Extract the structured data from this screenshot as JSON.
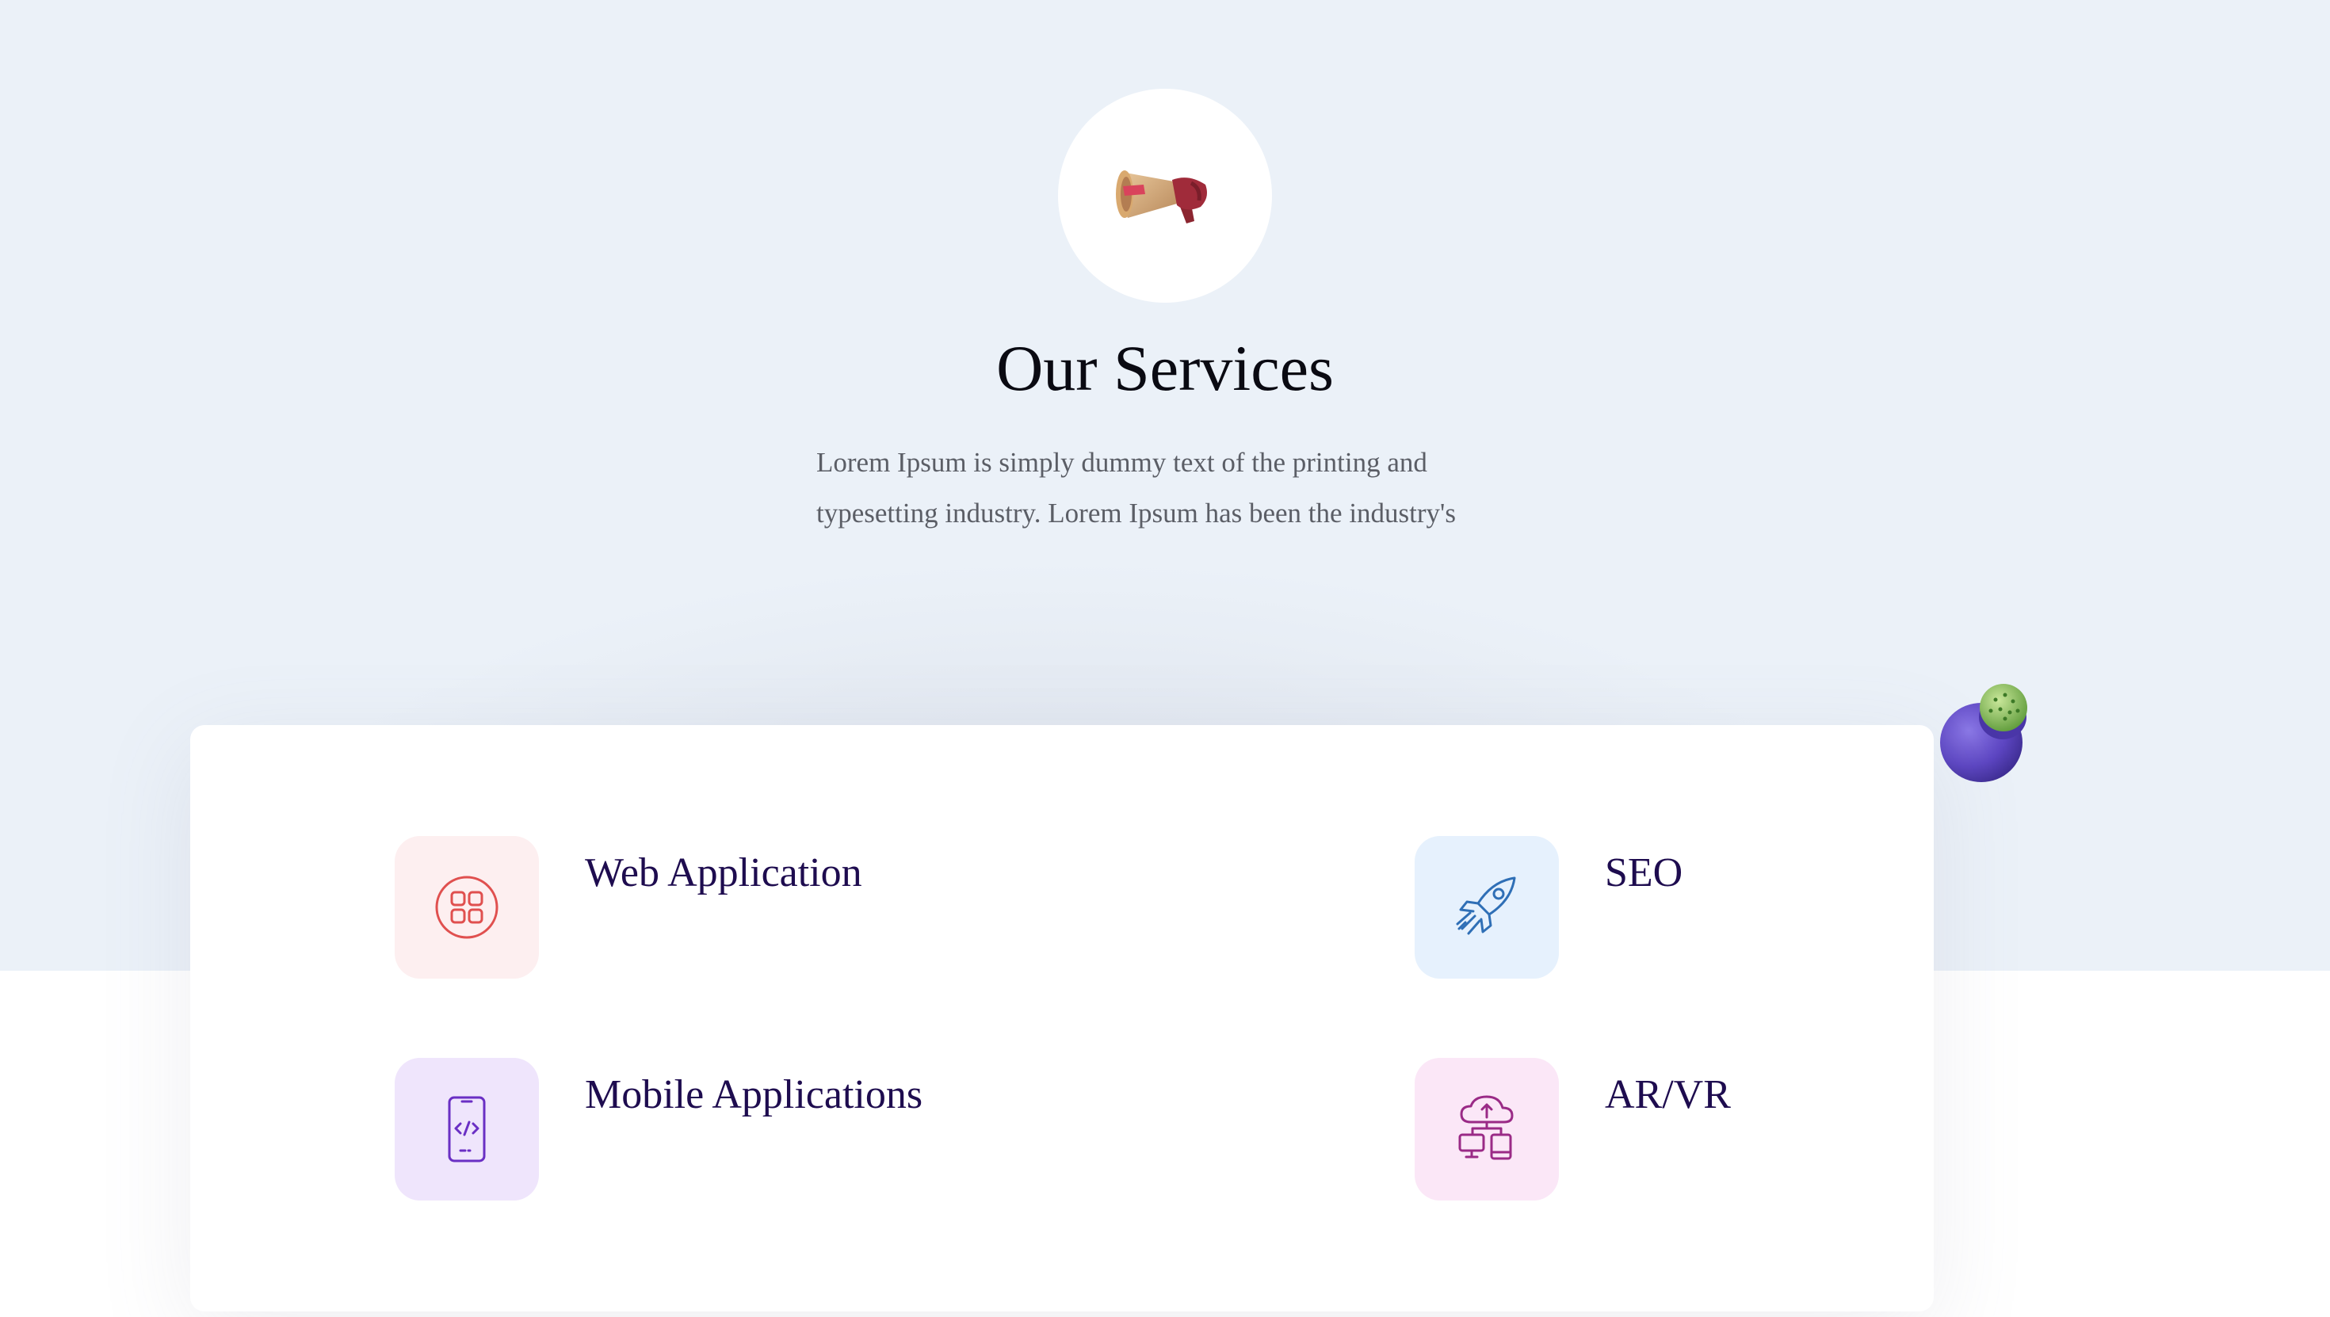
{
  "header": {
    "badge_icon": "megaphone-icon",
    "title": "Our Services",
    "description_lines": [
      "Lorem Ipsum is simply dummy text of the printing and",
      "typesetting industry. Lorem Ipsum has been the industry's"
    ]
  },
  "services": [
    {
      "title": "Web Application",
      "icon": "app-grid-icon",
      "tile_color": "#fdeff0",
      "icon_color": "#e0504f"
    },
    {
      "title": "SEO",
      "icon": "rocket-icon",
      "tile_color": "#e6f1fd",
      "icon_color": "#2f6fb6"
    },
    {
      "title": "Mobile Applications",
      "icon": "mobile-code-icon",
      "tile_color": "#efe5fc",
      "icon_color": "#6a2fc4"
    },
    {
      "title": "AR/VR",
      "icon": "cloud-devices-icon",
      "tile_color": "#fbe7f7",
      "icon_color": "#9a2a86"
    }
  ],
  "decoration": {
    "pot_icon": "cactus-pot-icon"
  }
}
